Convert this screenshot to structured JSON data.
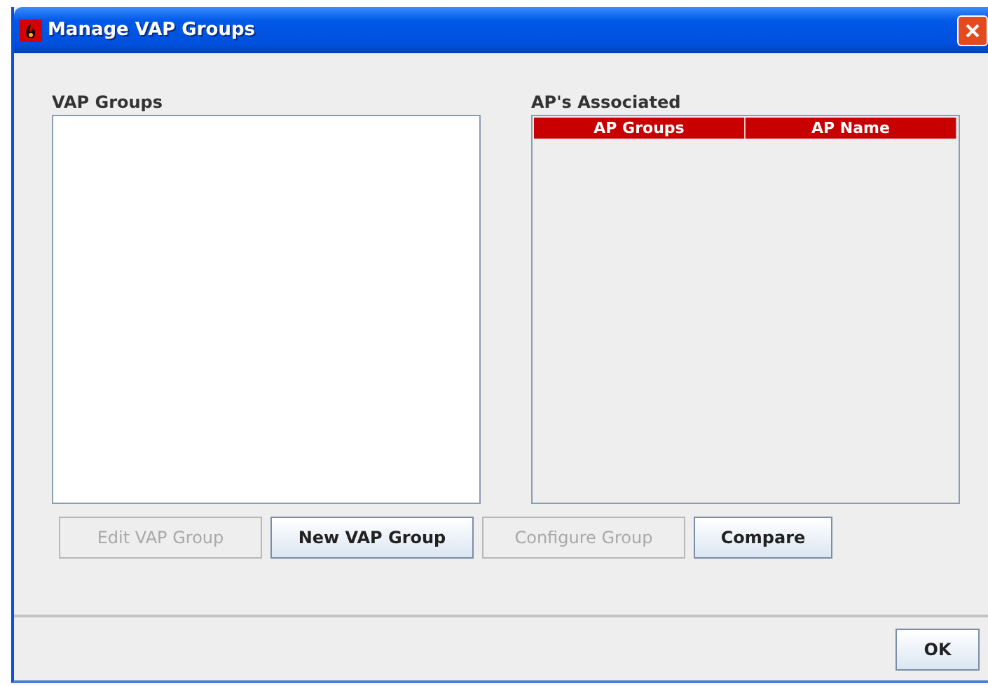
{
  "window": {
    "title": "Manage VAP Groups"
  },
  "vap_groups": {
    "label": "VAP Groups"
  },
  "aps_associated": {
    "label": "AP's Associated",
    "columns": [
      "AP Groups",
      "AP Name"
    ]
  },
  "buttons": [
    {
      "label": "Edit VAP Group",
      "disabled": true
    },
    {
      "label": "New VAP Group",
      "disabled": false
    },
    {
      "label": "Configure Group",
      "disabled": true
    },
    {
      "label": "Compare",
      "disabled": false
    }
  ],
  "footer_buttons": [
    {
      "label": "OK",
      "disabled": false
    }
  ]
}
